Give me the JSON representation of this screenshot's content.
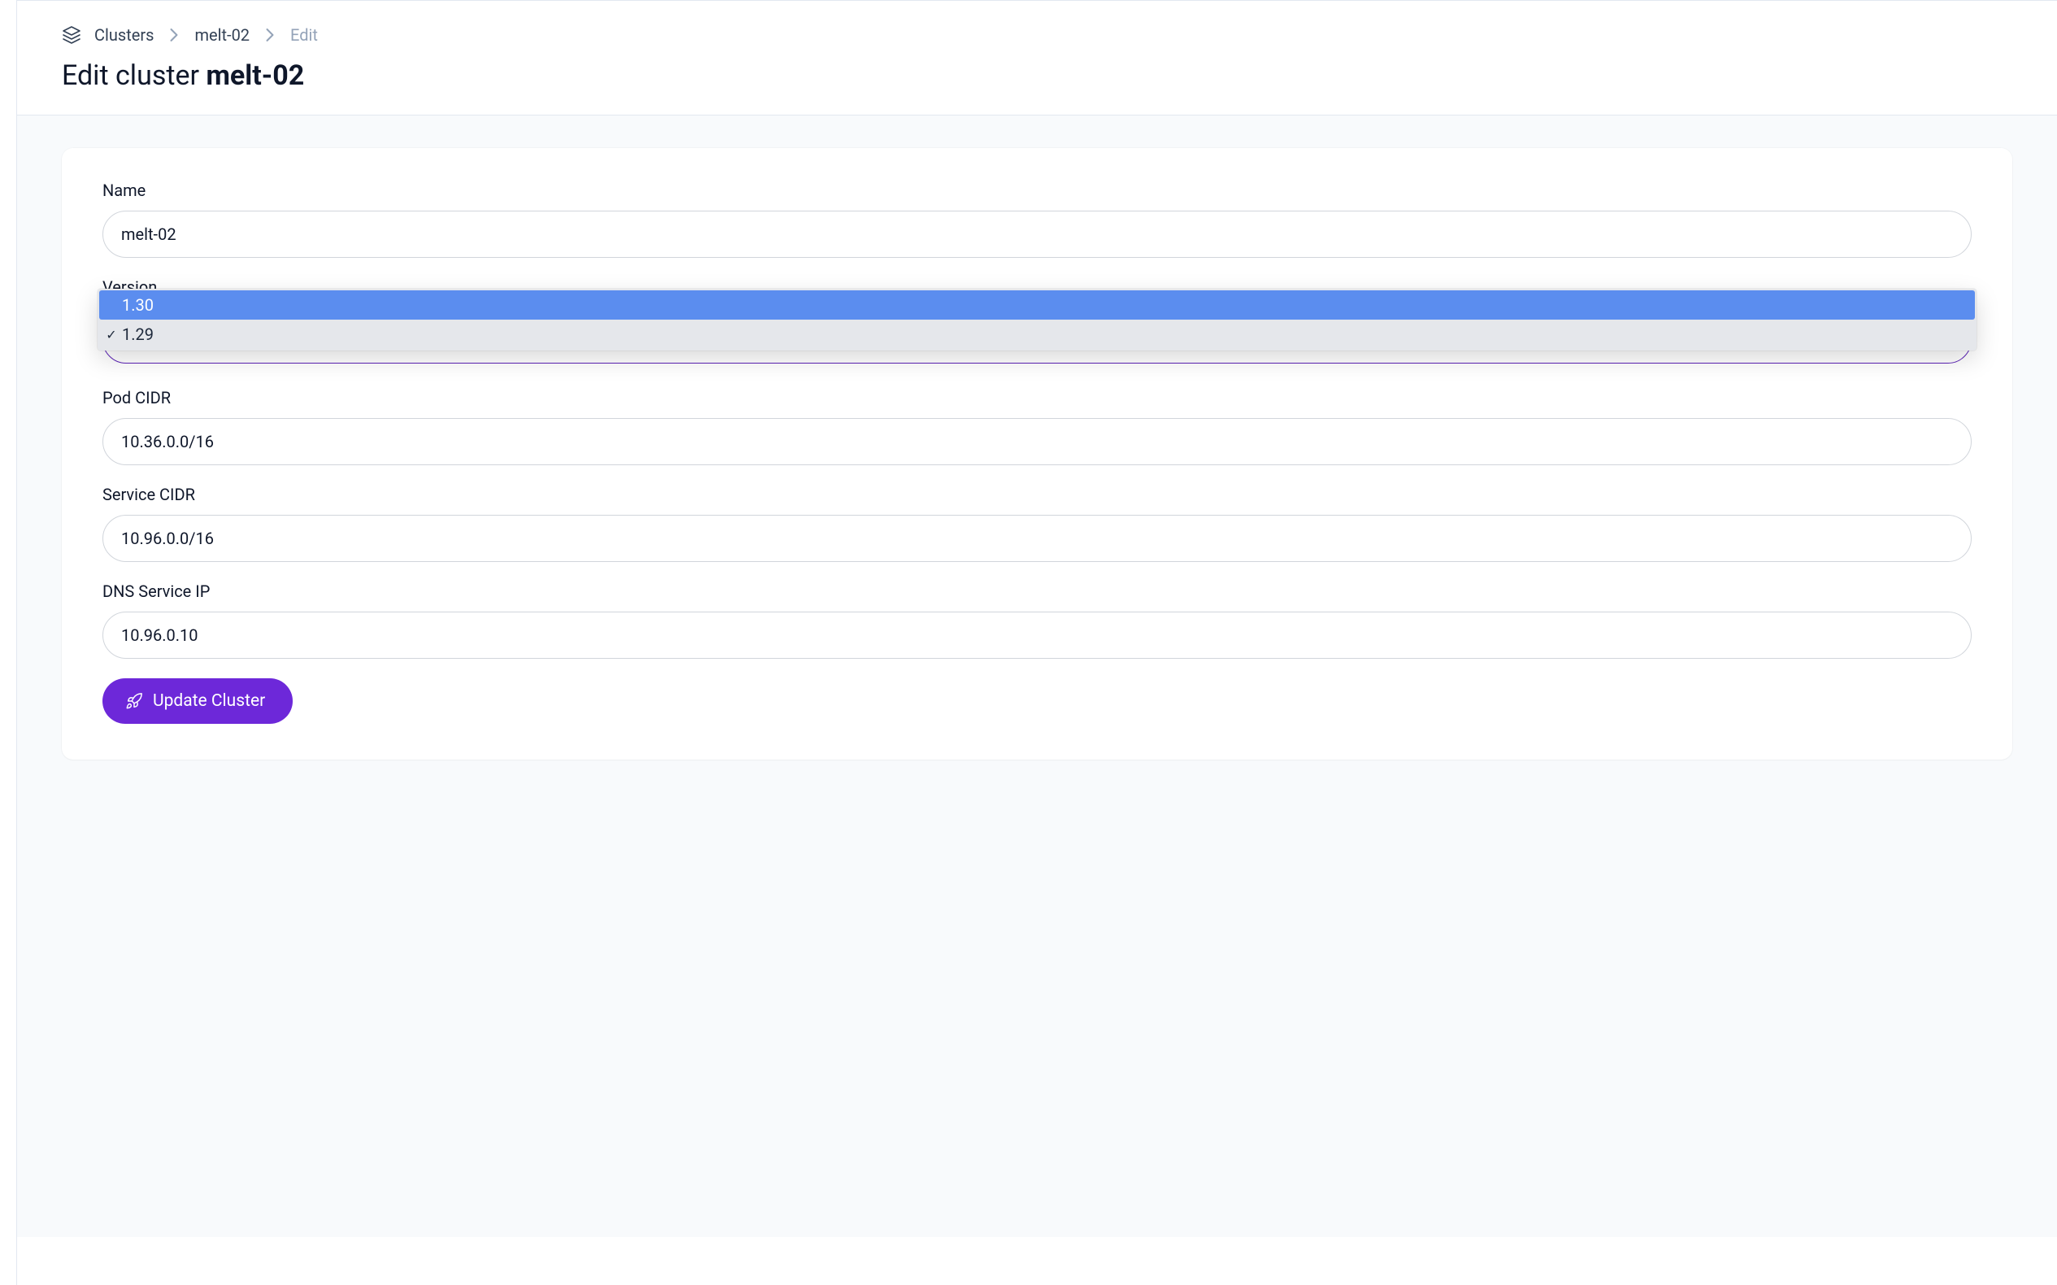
{
  "breadcrumb": {
    "root": "Clusters",
    "cluster": "melt-02",
    "current": "Edit"
  },
  "page": {
    "title_prefix": "Edit cluster ",
    "title_name": "melt-02"
  },
  "form": {
    "name": {
      "label": "Name",
      "value": "melt-02"
    },
    "version": {
      "label": "Version",
      "selected": "1.29",
      "options": [
        "1.30",
        "1.29"
      ],
      "highlighted": "1.30"
    },
    "pod_cidr": {
      "label": "Pod CIDR",
      "value": "10.36.0.0/16"
    },
    "service_cidr": {
      "label": "Service CIDR",
      "value": "10.96.0.0/16"
    },
    "dns_service_ip": {
      "label": "DNS Service IP",
      "value": "10.96.0.10"
    },
    "submit_label": "Update Cluster"
  }
}
